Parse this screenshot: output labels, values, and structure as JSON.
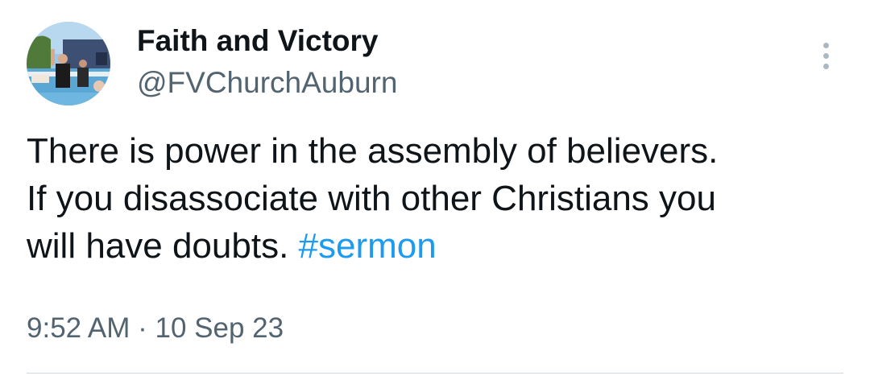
{
  "author": {
    "display_name": "Faith and Victory",
    "handle": "@FVChurchAuburn"
  },
  "tweet": {
    "lines": [
      "There is power in the assembly of believers.",
      "If you disassociate with other Christians you",
      "will have doubts. "
    ],
    "hashtag": "#sermon",
    "timestamp": "9:52 AM · 10 Sep 23"
  },
  "icons": {
    "more": "more-options-vertical-dots-icon"
  },
  "colors": {
    "text": "#0f1419",
    "secondary": "#536471",
    "link": "#1d9bf0",
    "divider": "#cfd9de"
  }
}
